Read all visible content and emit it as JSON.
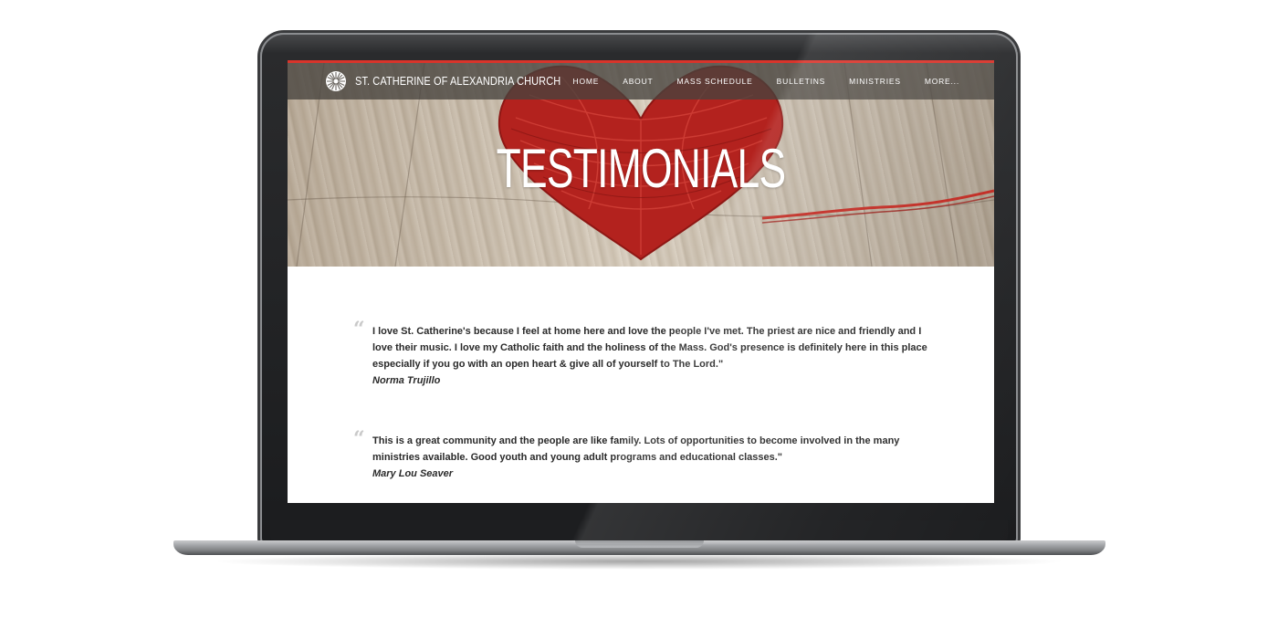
{
  "site": {
    "name": "ST. CATHERINE OF ALEXANDRIA CHURCH",
    "logo_icon": "church-logo-icon",
    "accent_color": "#d9342b"
  },
  "nav": {
    "items": [
      {
        "label": "HOME"
      },
      {
        "label": "ABOUT"
      },
      {
        "label": "MASS SCHEDULE"
      },
      {
        "label": "BULLETINS"
      },
      {
        "label": "MINISTRIES"
      },
      {
        "label": "MORE..."
      }
    ]
  },
  "hero": {
    "title": "TESTIMONIALS",
    "image": "red-yarn-heart-on-wood"
  },
  "testimonials": [
    {
      "quote": "I love St. Catherine's because I feel at home here and love the people I've met. The priest are nice and friendly and I love their music. I love my Catholic faith and the holiness of the Mass. God's presence is definitely here in this place especially if you go with an open heart & give all of yourself to The Lord.\"",
      "author": "Norma Trujillo"
    },
    {
      "quote": "This is a great community and the people are like family. Lots of opportunities to become involved in the many ministries available. Good youth and young adult programs and educational classes.\"",
      "author": "Mary Lou Seaver"
    }
  ],
  "quote_icon": "quote-icon"
}
